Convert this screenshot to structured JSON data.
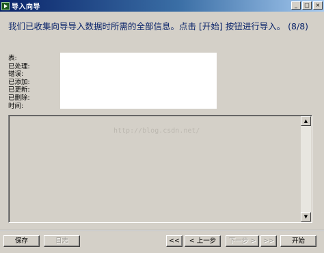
{
  "window": {
    "title": "导入向导",
    "minimize": "_",
    "maximize": "□",
    "close": "×"
  },
  "header": {
    "instruction": "我们已收集向导导入数据时所需的全部信息。点击 [开始] 按钮进行导入。 (8/8)"
  },
  "info": {
    "labels": [
      "表:",
      "已处理:",
      "错误:",
      "已添加:",
      "已更新:",
      "已删除:",
      "时间:"
    ]
  },
  "log": {
    "watermark": "http://blog.csdn.net/",
    "scroll_up": "▲",
    "scroll_down": "▼"
  },
  "buttons": {
    "save": "保存",
    "log": "日志",
    "first": "<<",
    "prev": "< 上一步",
    "next": "下一步 >",
    "last": ">>",
    "start": "开始"
  }
}
